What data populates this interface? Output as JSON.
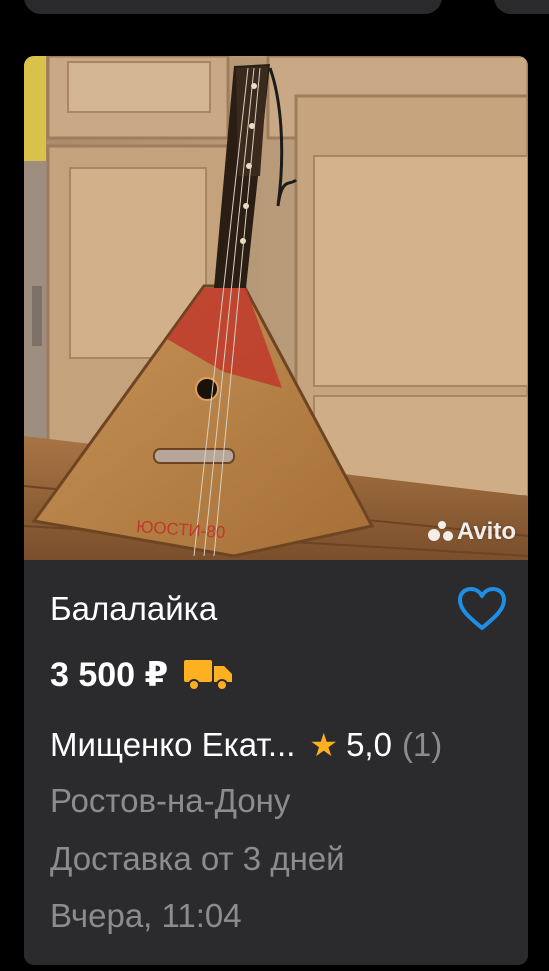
{
  "listing": {
    "photo_watermark": "Avito",
    "title": "Балалайка",
    "price": "3 500 ₽",
    "seller_name": "Мищенко Екат...",
    "rating": "5,0",
    "reviews_count": "(1)",
    "city": "Ростов-на-Дону",
    "delivery": "Доставка от 3 дней",
    "date": "Вчера, 11:04",
    "balalaika_inscription": "ЮОСТИ-80"
  },
  "icons": {
    "favorite": "heart-outline-icon",
    "delivery": "delivery-truck-icon",
    "rating": "star-icon"
  },
  "colors": {
    "card_bg": "#2b2b2d",
    "page_bg": "#000000",
    "favorite_icon": "#1e8fe8",
    "delivery_icon": "#ffb020",
    "star": "#ffb020",
    "secondary_text": "#8c8c8e"
  }
}
